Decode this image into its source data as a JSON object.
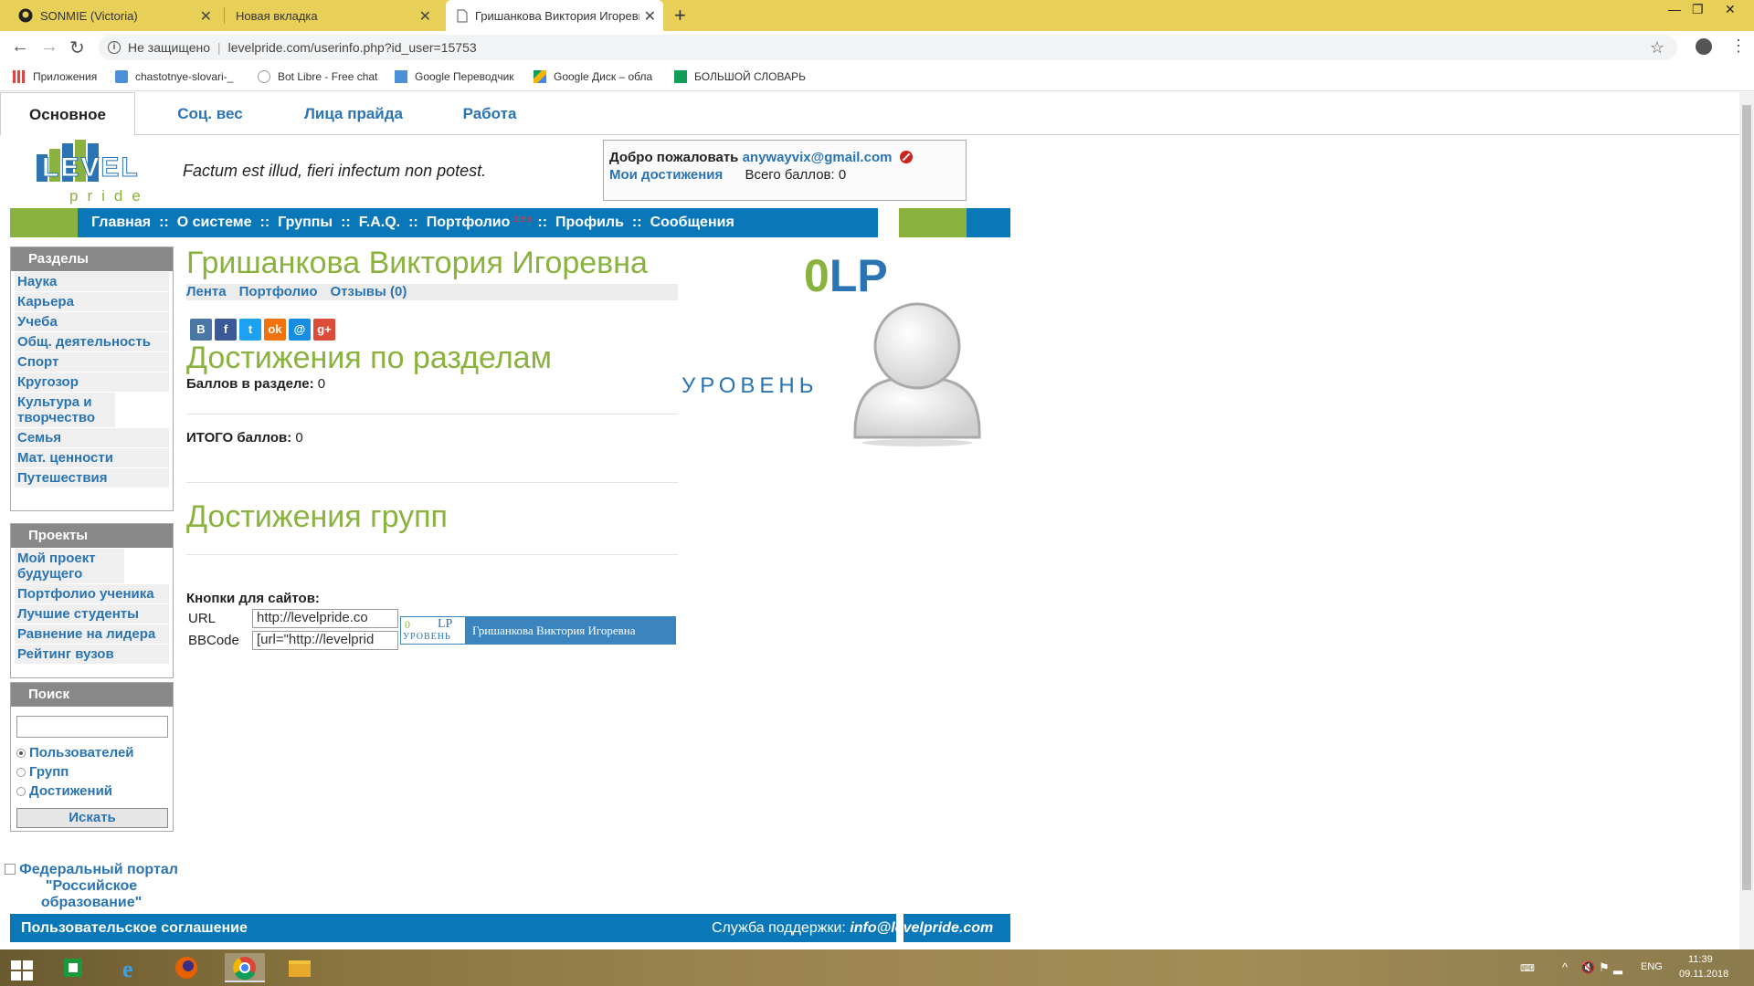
{
  "browser": {
    "tabs": [
      {
        "title": "SONMIE (Victoria)",
        "icon": "github-icon"
      },
      {
        "title": "Новая вкладка",
        "icon": "none"
      },
      {
        "title": "Гришанкова Виктория Игоревна",
        "icon": "page-icon"
      }
    ],
    "active_tab": 2,
    "security_label": "Не защищено",
    "url": "levelpride.com/userinfo.php?id_user=15753",
    "bookmarks": [
      {
        "label": "Приложения",
        "icon": "apps-grid-icon"
      },
      {
        "label": "chastotnye-slovari-_",
        "icon": "drive-folder-icon"
      },
      {
        "label": "Bot Libre - Free chat",
        "icon": "bot-icon"
      },
      {
        "label": "Google Переводчик",
        "icon": "translate-icon"
      },
      {
        "label": "Google Диск – обла",
        "icon": "google-drive-icon"
      },
      {
        "label": "БОЛЬШОЙ СЛОВАРЬ",
        "icon": "sheets-icon"
      }
    ]
  },
  "site": {
    "top_tabs": [
      "Основное",
      "Соц. вес",
      "Лица прайда",
      "Работа"
    ],
    "active_top_tab": 0,
    "logo": {
      "main": "LEVEL",
      "sub": "pride"
    },
    "motto": "Factum est illud, fieri infectum non potest.",
    "welcome": {
      "greeting": "Добро пожаловать",
      "email": "anywayvix@gmail.com",
      "achievements_link": "Мои достижения",
      "total_label": "Всего баллов: 0"
    },
    "main_nav": [
      "Главная",
      "О системе",
      "Группы",
      "F.A.Q.",
      "Портфолио",
      "Профиль",
      "Сообщения"
    ],
    "nav_separator": "::",
    "beta_tag": "beta",
    "sidebar": {
      "sections_title": "Разделы",
      "sections": [
        "Наука",
        "Карьера",
        "Учеба",
        "Общ. деятельность",
        "Спорт",
        "Кругозор",
        "Культура и творчество",
        "Семья",
        "Мат. ценности",
        "Путешествия"
      ],
      "projects_title": "Проекты",
      "projects": [
        "Мой проект будущего",
        "Портфолио ученика",
        "Лучшие студенты",
        "Равнение на лидера",
        "Рейтинг вузов"
      ],
      "search_title": "Поиск",
      "search_options": [
        "Пользователей",
        "Групп",
        "Достижений"
      ],
      "search_selected": 0,
      "search_button": "Искать"
    },
    "profile": {
      "name": "Гришанкова Виктория Игоревна",
      "subnav": [
        "Лента",
        "Портфолио",
        "Отзывы (0)"
      ],
      "share_icons": [
        {
          "name": "vk-icon",
          "glyph": "В",
          "color": "#4a76a8"
        },
        {
          "name": "facebook-icon",
          "glyph": "f",
          "color": "#3b5998"
        },
        {
          "name": "twitter-icon",
          "glyph": "t",
          "color": "#1da1f2"
        },
        {
          "name": "odnoklassniki-icon",
          "glyph": "ok",
          "color": "#f2720c"
        },
        {
          "name": "mailru-icon",
          "glyph": "@",
          "color": "#168de2"
        },
        {
          "name": "googleplus-icon",
          "glyph": "g+",
          "color": "#dd4b39"
        }
      ],
      "achievements_title": "Достижения по разделам",
      "section_points_label": "Баллов в разделе:",
      "section_points_value": "0",
      "total_points_label": "ИТОГО баллов:",
      "total_points_value": "0",
      "groups_title": "Достижения групп",
      "buttons_label": "Кнопки для сайтов:",
      "url_label": "URL",
      "url_value": "http://levelpride.co",
      "bbcode_label": "BBCode",
      "bbcode_value": "[url=\"http://levelprid",
      "badge": {
        "points": "0",
        "unit": "LP",
        "level_word": "УРОВЕНЬ",
        "name": "Гришанкова Виктория Игоревна"
      }
    },
    "level": {
      "value": "0",
      "unit": "LP",
      "word": "УРОВЕНЬ"
    },
    "footer": {
      "portal_link": "Федеральный портал \"Российское образование\"",
      "agreement": "Пользовательское соглашение",
      "support_label": "Служба поддержки:",
      "support_email": "info@levelpride.com"
    }
  },
  "taskbar": {
    "apps": [
      "store-icon",
      "internet-explorer-icon",
      "firefox-icon",
      "chrome-icon",
      "file-explorer-icon"
    ],
    "active_app": 3,
    "lang": "ENG",
    "time": "11:39",
    "date": "09.11.2018"
  },
  "colors": {
    "brand_blue": "#0a78b8",
    "brand_green": "#8ab23e",
    "link_blue": "#2a74b3",
    "tabbar": "#e8cf58"
  }
}
